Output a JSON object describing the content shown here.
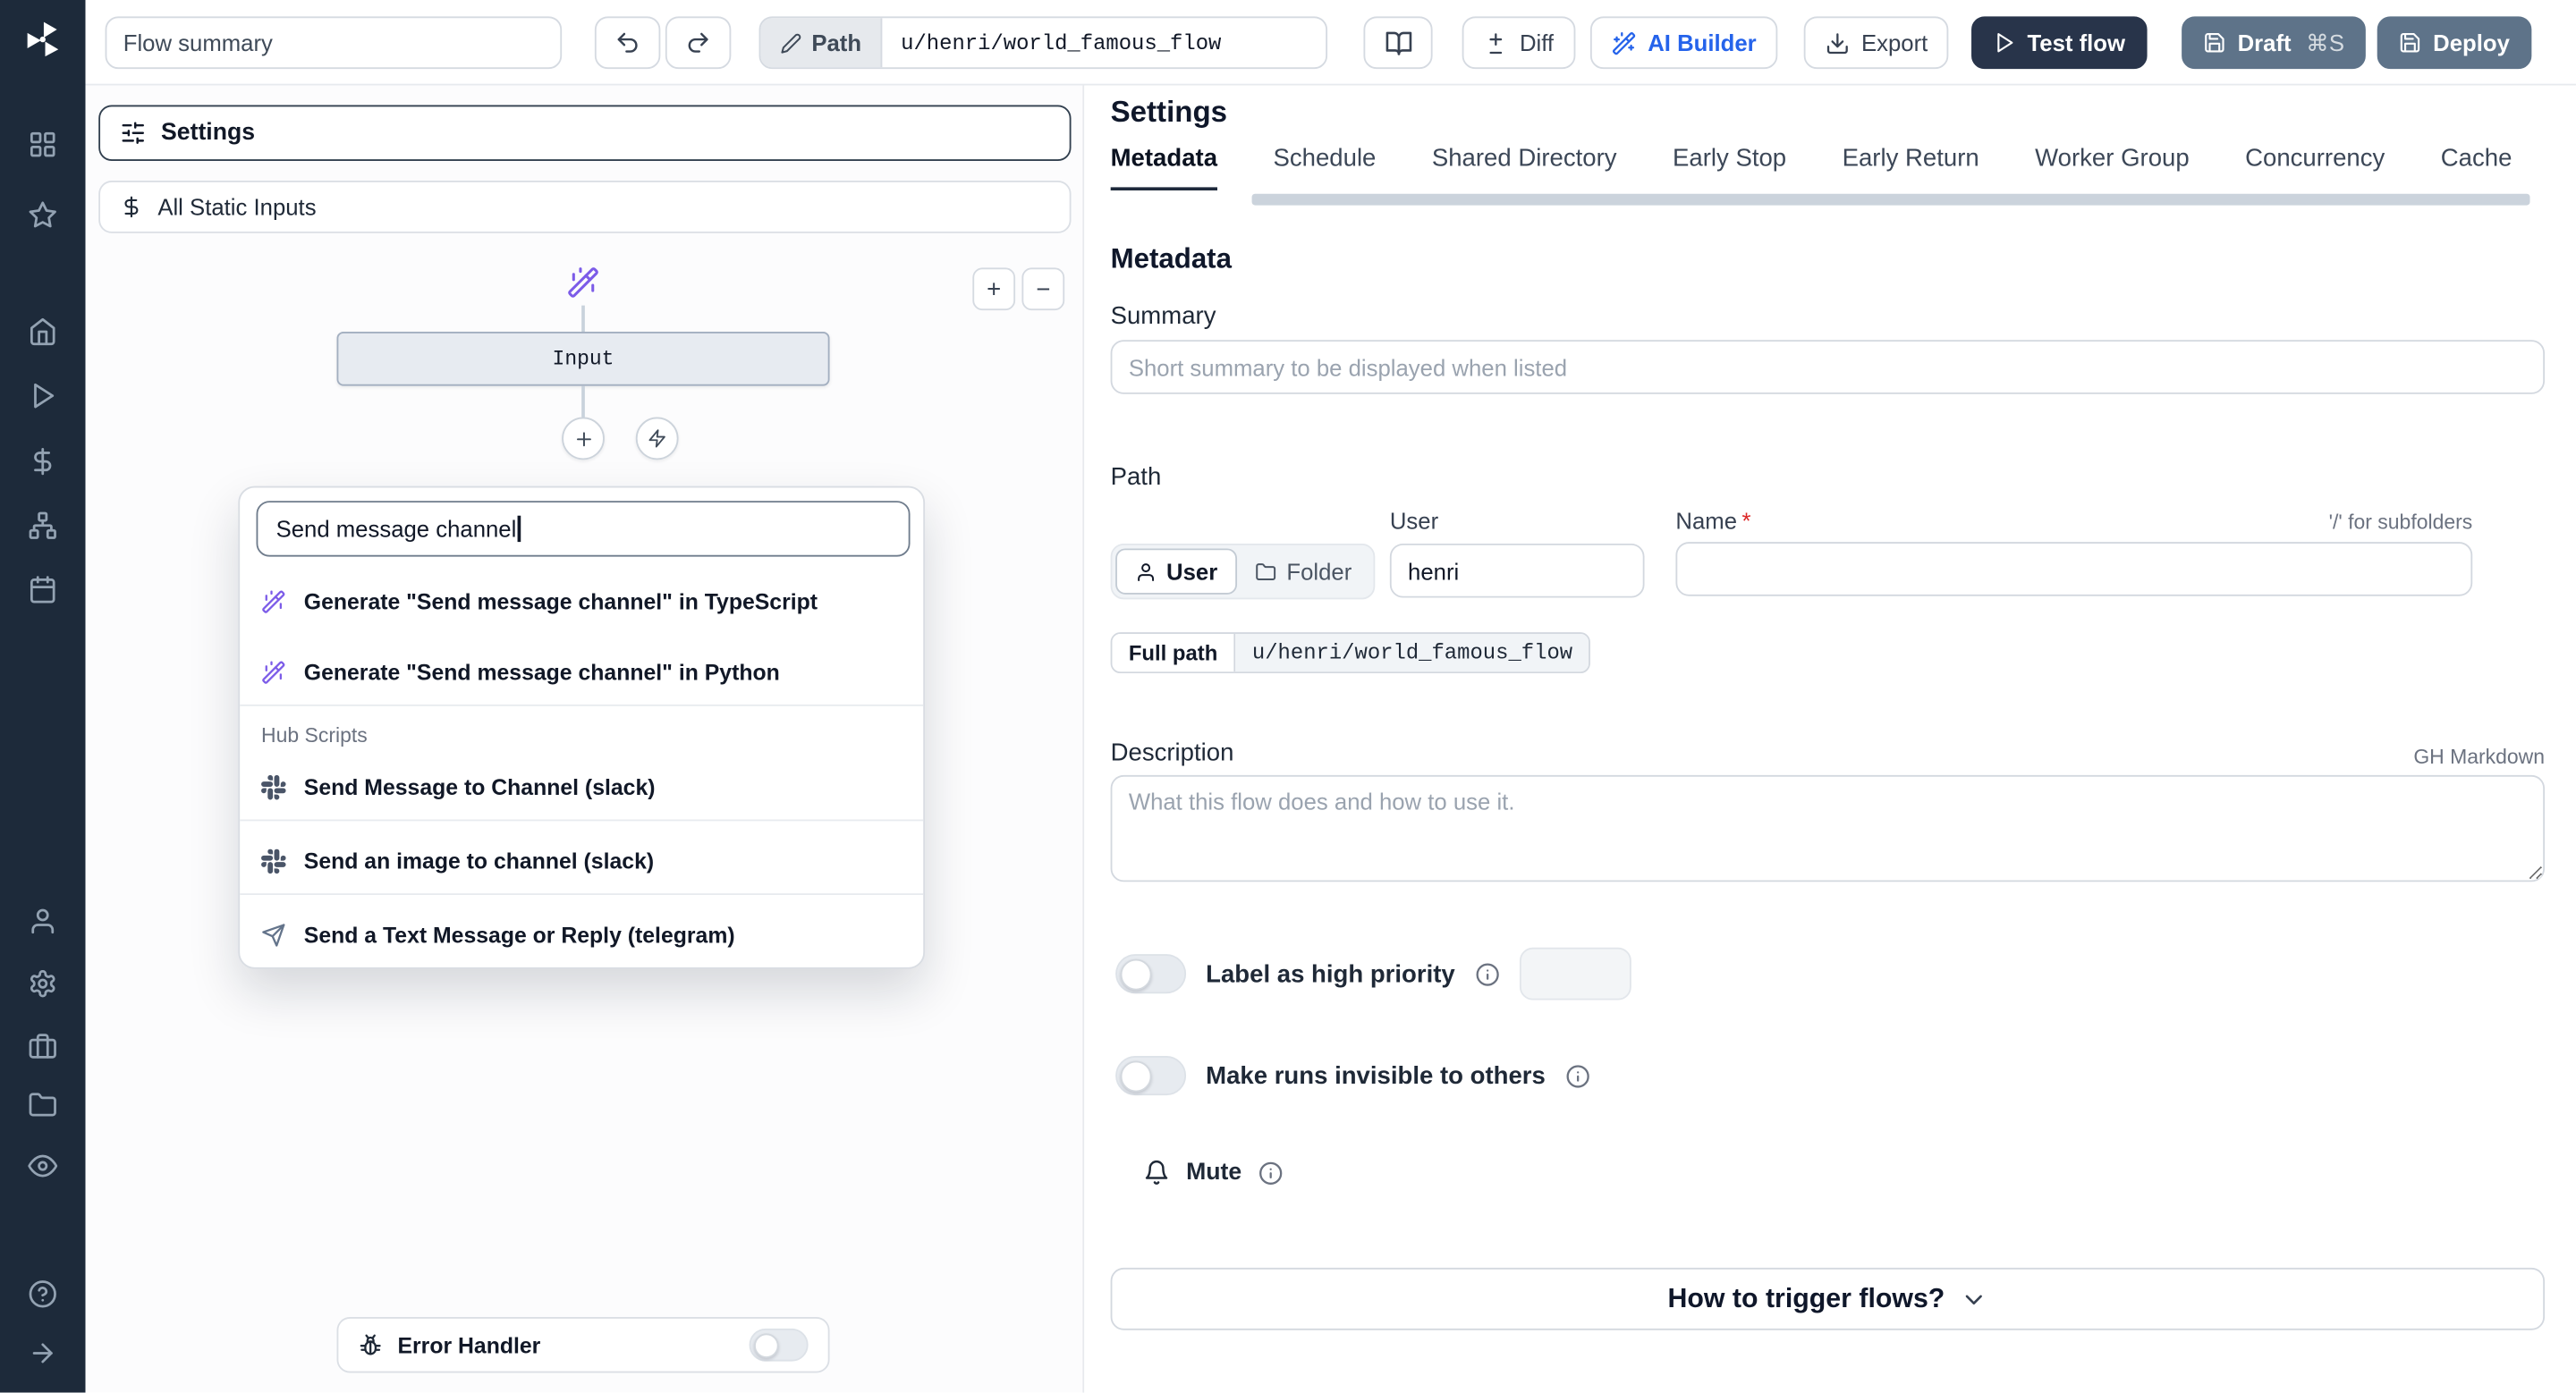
{
  "colors": {
    "sidebar_bg": "#1d2a3a",
    "accent_blue": "#2563eb",
    "dark_button": "#28344a",
    "slate_button": "#5e7389",
    "wand_purple": "#7c5ce8",
    "active_tab_underline": "#1e293b"
  },
  "sidebar": {
    "icons": [
      "windmill-logo",
      "apps-grid",
      "favorites-star",
      "home",
      "runs-play",
      "variables-dollar",
      "flows-graph",
      "schedules-calendar",
      "user",
      "settings-gear",
      "workers-briefcase",
      "folders",
      "audit-eye",
      "help-circle",
      "collapse-arrow-right"
    ]
  },
  "topbar": {
    "summary_placeholder": "Flow summary",
    "path_label": "Path",
    "path_value": "u/henri/world_famous_flow",
    "diff_label": "Diff",
    "ai_builder_label": "AI Builder",
    "export_label": "Export",
    "test_flow_label": "Test flow",
    "draft_label": "Draft",
    "draft_shortcut": "⌘S",
    "deploy_label": "Deploy"
  },
  "flow_panel": {
    "settings_button": "Settings",
    "static_inputs_button": "All Static Inputs",
    "input_node": "Input",
    "zoom_in": "+",
    "zoom_out": "−",
    "error_handler_label": "Error Handler",
    "search": {
      "value": "Send message channel",
      "generate_results": [
        "Generate \"Send message channel\" in TypeScript",
        "Generate \"Send message channel\" in Python"
      ],
      "hub_section_label": "Hub Scripts",
      "hub_results": [
        "Send Message to Channel (slack)",
        "Send an image to channel (slack)",
        "Send a Text Message or Reply (telegram)"
      ]
    }
  },
  "settings": {
    "title": "Settings",
    "tabs": [
      "Metadata",
      "Schedule",
      "Shared Directory",
      "Early Stop",
      "Early Return",
      "Worker Group",
      "Concurrency",
      "Cache"
    ],
    "active_tab": "Metadata",
    "section_heading": "Metadata",
    "summary_label": "Summary",
    "summary_placeholder": "Short summary to be displayed when listed",
    "path_label": "Path",
    "owner_kind_user": "User",
    "owner_kind_folder": "Folder",
    "user_field_label": "User",
    "user_value": "henri",
    "name_label": "Name",
    "required_marker": "*",
    "subfolder_hint": "'/' for subfolders",
    "full_path_label": "Full path",
    "full_path_value": "u/henri/world_famous_flow",
    "description_label": "Description",
    "markdown_hint": "GH Markdown",
    "description_placeholder": "What this flow does and how to use it.",
    "high_priority_label": "Label as high priority",
    "invisible_runs_label": "Make runs invisible to others",
    "mute_label": "Mute",
    "trigger_help_label": "How to trigger flows?"
  }
}
